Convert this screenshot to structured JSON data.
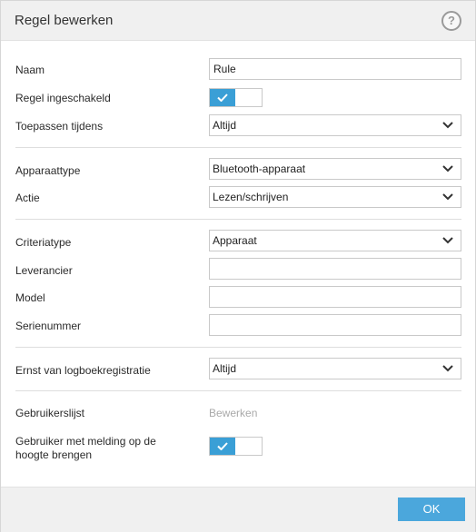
{
  "dialog": {
    "title": "Regel bewerken",
    "help_label": "?"
  },
  "fields": {
    "name_label": "Naam",
    "name_value": "Rule",
    "enabled_label": "Regel ingeschakeld",
    "enabled": true,
    "apply_label": "Toepassen tijdens",
    "apply_value": "Altijd",
    "device_type_label": "Apparaattype",
    "device_type_value": "Bluetooth-apparaat",
    "action_label": "Actie",
    "action_value": "Lezen/schrijven",
    "criteria_label": "Criteriatype",
    "criteria_value": "Apparaat",
    "vendor_label": "Leverancier",
    "vendor_value": "",
    "model_label": "Model",
    "model_value": "",
    "serial_label": "Serienummer",
    "serial_value": "",
    "severity_label": "Ernst van logboekregistratie",
    "severity_value": "Altijd",
    "userlist_label": "Gebruikerslijst",
    "userlist_link": "Bewerken",
    "notify_label_line1": "Gebruiker met melding op de",
    "notify_label_line2": "hoogte brengen",
    "notify_enabled": true
  },
  "footer": {
    "ok_label": "OK"
  },
  "colors": {
    "accent": "#3a9fd6",
    "ok_button": "#4ba7dc",
    "header_bg": "#f0f0f0"
  },
  "icons": {
    "help": "question-circle-icon",
    "dropdown": "chevron-down-icon",
    "toggle_on": "checkmark-icon"
  }
}
